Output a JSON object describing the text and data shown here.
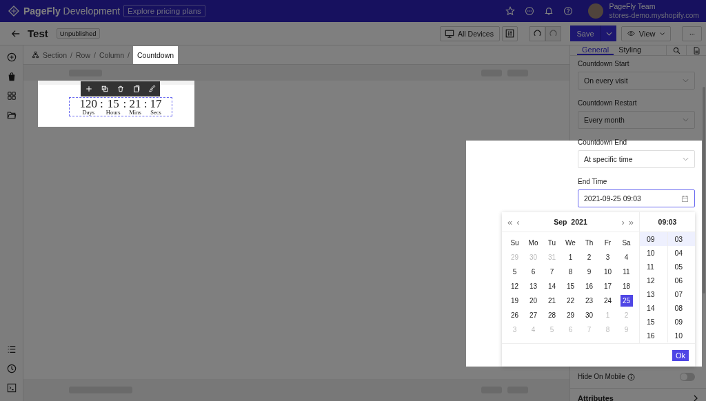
{
  "top_bar": {
    "brand": "PageFly",
    "brand_suffix": "Development",
    "pricing_link": "Explore pricing plans",
    "user": {
      "name": "PageFly Team",
      "store": "stores-demo.myshopify.com"
    }
  },
  "toolbar": {
    "page_title": "Test",
    "status_badge": "Unpublished",
    "device_button": "All Devices",
    "save_button": "Save",
    "view_button": "View",
    "more_button": "···"
  },
  "breadcrumb": [
    {
      "label": "Section",
      "separator": "/",
      "highlighted": false
    },
    {
      "label": "Row",
      "separator": "/",
      "highlighted": false
    },
    {
      "label": "Column",
      "separator": "/",
      "highlighted": false
    },
    {
      "label": "Countdown",
      "highlighted": true
    }
  ],
  "countdown": {
    "highlighted": true,
    "units": [
      {
        "value": "120",
        "label": "Days",
        "separator": ":"
      },
      {
        "value": "15",
        "label": "Hours",
        "separator": ":"
      },
      {
        "value": "21",
        "label": "Mins",
        "separator": ":"
      },
      {
        "value": "17",
        "label": "Secs"
      }
    ]
  },
  "panel": {
    "tabs": [
      {
        "label": "General",
        "selected": true
      },
      {
        "label": "Styling",
        "selected": false
      }
    ],
    "fields": [
      {
        "label": "Countdown Start",
        "kind": "select",
        "value": "On every visit",
        "highlighted": false,
        "focused": false
      },
      {
        "label": "Countdown Restart",
        "kind": "select",
        "value": "Every month",
        "highlighted": false,
        "focused": false
      },
      {
        "label": "Countdown End",
        "kind": "select",
        "value": "At specific time",
        "highlighted": true,
        "focused": false
      },
      {
        "label": "End Time",
        "kind": "date",
        "value": "2021-09-25 09:03",
        "highlighted": true,
        "focused": true
      }
    ],
    "hide_on_mobile": {
      "label": "Hide On Mobile",
      "on": false
    },
    "sections": [
      {
        "label": "Attributes"
      }
    ]
  },
  "date_picker": {
    "prev_nav": [
      "«",
      "‹"
    ],
    "next_nav": [
      "›",
      "»"
    ],
    "month": "Sep",
    "year": "2021",
    "time": "09:03",
    "weekdays": [
      "Su",
      "Mo",
      "Tu",
      "We",
      "Th",
      "Fr",
      "Sa"
    ],
    "weeks": [
      [
        {
          "day": "29",
          "muted": true,
          "selected": false
        },
        {
          "day": "30",
          "muted": true,
          "selected": false
        },
        {
          "day": "31",
          "muted": true,
          "selected": false
        },
        {
          "day": "1",
          "muted": false,
          "selected": false
        },
        {
          "day": "2",
          "muted": false,
          "selected": false
        },
        {
          "day": "3",
          "muted": false,
          "selected": false
        },
        {
          "day": "4",
          "muted": false,
          "selected": false
        }
      ],
      [
        {
          "day": "5",
          "muted": false,
          "selected": false
        },
        {
          "day": "6",
          "muted": false,
          "selected": false
        },
        {
          "day": "7",
          "muted": false,
          "selected": false
        },
        {
          "day": "8",
          "muted": false,
          "selected": false
        },
        {
          "day": "9",
          "muted": false,
          "selected": false
        },
        {
          "day": "10",
          "muted": false,
          "selected": false
        },
        {
          "day": "11",
          "muted": false,
          "selected": false
        }
      ],
      [
        {
          "day": "12",
          "muted": false,
          "selected": false
        },
        {
          "day": "13",
          "muted": false,
          "selected": false
        },
        {
          "day": "14",
          "muted": false,
          "selected": false
        },
        {
          "day": "15",
          "muted": false,
          "selected": false
        },
        {
          "day": "16",
          "muted": false,
          "selected": false
        },
        {
          "day": "17",
          "muted": false,
          "selected": false
        },
        {
          "day": "18",
          "muted": false,
          "selected": false
        }
      ],
      [
        {
          "day": "19",
          "muted": false,
          "selected": false
        },
        {
          "day": "20",
          "muted": false,
          "selected": false
        },
        {
          "day": "21",
          "muted": false,
          "selected": false
        },
        {
          "day": "22",
          "muted": false,
          "selected": false
        },
        {
          "day": "23",
          "muted": false,
          "selected": false
        },
        {
          "day": "24",
          "muted": false,
          "selected": false
        },
        {
          "day": "25",
          "muted": false,
          "selected": true
        }
      ],
      [
        {
          "day": "26",
          "muted": false,
          "selected": false
        },
        {
          "day": "27",
          "muted": false,
          "selected": false
        },
        {
          "day": "28",
          "muted": false,
          "selected": false
        },
        {
          "day": "29",
          "muted": false,
          "selected": false
        },
        {
          "day": "30",
          "muted": false,
          "selected": false
        },
        {
          "day": "1",
          "muted": true,
          "selected": false
        },
        {
          "day": "2",
          "muted": true,
          "selected": false
        }
      ],
      [
        {
          "day": "3",
          "muted": true,
          "selected": false
        },
        {
          "day": "4",
          "muted": true,
          "selected": false
        },
        {
          "day": "5",
          "muted": true,
          "selected": false
        },
        {
          "day": "6",
          "muted": true,
          "selected": false
        },
        {
          "day": "7",
          "muted": true,
          "selected": false
        },
        {
          "day": "8",
          "muted": true,
          "selected": false
        },
        {
          "day": "9",
          "muted": true,
          "selected": false
        }
      ]
    ],
    "hours": [
      {
        "label": "09",
        "selected": true
      },
      {
        "label": "10",
        "selected": false
      },
      {
        "label": "11",
        "selected": false
      },
      {
        "label": "12",
        "selected": false
      },
      {
        "label": "13",
        "selected": false
      },
      {
        "label": "14",
        "selected": false
      },
      {
        "label": "15",
        "selected": false
      },
      {
        "label": "16",
        "selected": false
      }
    ],
    "minutes": [
      {
        "label": "03",
        "selected": true
      },
      {
        "label": "04",
        "selected": false
      },
      {
        "label": "05",
        "selected": false
      },
      {
        "label": "06",
        "selected": false
      },
      {
        "label": "07",
        "selected": false
      },
      {
        "label": "08",
        "selected": false
      },
      {
        "label": "09",
        "selected": false
      },
      {
        "label": "10",
        "selected": false
      }
    ],
    "ok_button": "Ok"
  }
}
